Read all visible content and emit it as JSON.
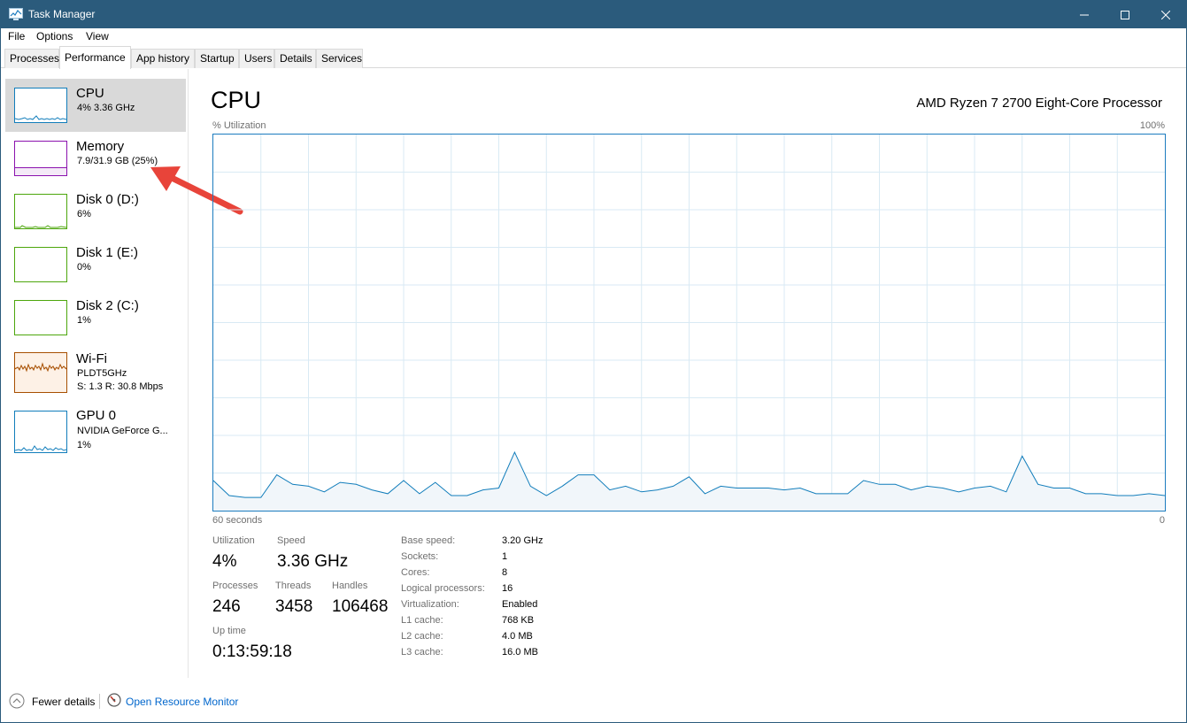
{
  "window": {
    "title": "Task Manager",
    "controls": {
      "minimize_icon": "minimize-icon",
      "maximize_icon": "maximize-icon",
      "close_icon": "close-icon"
    }
  },
  "menu": {
    "items": [
      "File",
      "Options",
      "View"
    ]
  },
  "tabs": [
    "Processes",
    "Performance",
    "App history",
    "Startup",
    "Users",
    "Details",
    "Services"
  ],
  "active_tab": "Performance",
  "sidebar": {
    "items": [
      {
        "title": "CPU",
        "sub1": "4% 3.36 GHz",
        "sub2": "",
        "color": "#117dbb",
        "selected": true
      },
      {
        "title": "Memory",
        "sub1": "7.9/31.9 GB (25%)",
        "sub2": "",
        "color": "#8b12ae",
        "selected": false
      },
      {
        "title": "Disk 0 (D:)",
        "sub1": "6%",
        "sub2": "",
        "color": "#4da60c",
        "selected": false
      },
      {
        "title": "Disk 1 (E:)",
        "sub1": "0%",
        "sub2": "",
        "color": "#4da60c",
        "selected": false
      },
      {
        "title": "Disk 2 (C:)",
        "sub1": "1%",
        "sub2": "",
        "color": "#4da60c",
        "selected": false
      },
      {
        "title": "Wi-Fi",
        "sub1": "PLDT5GHz",
        "sub2": "S: 1.3 R: 30.8 Mbps",
        "color": "#a74f01",
        "selected": false
      },
      {
        "title": "GPU 0",
        "sub1": "NVIDIA GeForce G...",
        "sub2": "1%",
        "color": "#117dbb",
        "selected": false
      }
    ]
  },
  "main": {
    "title": "CPU",
    "model": "AMD Ryzen 7 2700 Eight-Core Processor",
    "graph": {
      "top_left_label": "% Utilization",
      "top_right_label": "100%",
      "bottom_left_label": "60 seconds",
      "bottom_right_label": "0",
      "line_color": "#117dbb",
      "fill_color": "#f1f6fa",
      "grid_color": "#d9eaf4"
    },
    "stats": {
      "utilization_label": "Utilization",
      "utilization_value": "4%",
      "speed_label": "Speed",
      "speed_value": "3.36 GHz",
      "processes_label": "Processes",
      "processes_value": "246",
      "threads_label": "Threads",
      "threads_value": "3458",
      "handles_label": "Handles",
      "handles_value": "106468",
      "uptime_label": "Up time",
      "uptime_value": "0:13:59:18"
    },
    "details": [
      {
        "label": "Base speed:",
        "value": "3.20 GHz"
      },
      {
        "label": "Sockets:",
        "value": "1"
      },
      {
        "label": "Cores:",
        "value": "8"
      },
      {
        "label": "Logical processors:",
        "value": "16"
      },
      {
        "label": "Virtualization:",
        "value": "Enabled"
      },
      {
        "label": "L1 cache:",
        "value": "768 KB"
      },
      {
        "label": "L2 cache:",
        "value": "4.0 MB"
      },
      {
        "label": "L3 cache:",
        "value": "16.0 MB"
      }
    ]
  },
  "chart_data": {
    "type": "area",
    "ylim": [
      0,
      100
    ],
    "x": [
      60,
      59,
      58,
      57,
      56,
      55,
      54,
      53,
      52,
      51,
      50,
      49,
      48,
      47,
      46,
      45,
      44,
      43,
      42,
      41,
      40,
      39,
      38,
      37,
      36,
      35,
      34,
      33,
      32,
      31,
      30,
      29,
      28,
      27,
      26,
      25,
      24,
      23,
      22,
      21,
      20,
      19,
      18,
      17,
      16,
      15,
      14,
      13,
      12,
      11,
      10,
      9,
      8,
      7,
      6,
      5,
      4,
      3,
      2,
      1,
      0
    ],
    "series": [
      {
        "values": [
          8,
          4,
          3.5,
          3.5,
          9.5,
          7,
          6.5,
          5,
          7.5,
          7,
          5.5,
          4.5,
          8,
          4.5,
          7.5,
          4,
          4,
          5.5,
          6,
          15.5,
          6.5,
          4,
          6.5,
          9.5,
          9.5,
          5.5,
          6.5,
          5,
          5.5,
          6.5,
          9,
          4.5,
          6.5,
          6,
          6,
          6,
          5.5,
          6,
          4.5,
          4.5,
          4.5,
          8,
          7,
          7,
          5.5,
          6.5,
          6,
          5,
          6,
          6.5,
          5,
          14.5,
          7,
          6,
          6,
          4.5,
          4.5,
          4,
          4,
          4.5,
          4
        ]
      }
    ]
  },
  "footer": {
    "fewer_details": "Fewer details",
    "open_resource_monitor": "Open Resource Monitor"
  }
}
